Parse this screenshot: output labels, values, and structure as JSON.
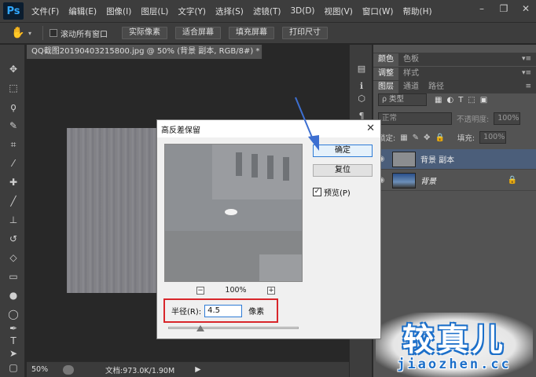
{
  "menubar": {
    "logo": "Ps",
    "items": [
      "文件(F)",
      "编辑(E)",
      "图像(I)",
      "图层(L)",
      "文字(Y)",
      "选择(S)",
      "滤镜(T)",
      "3D(D)",
      "视图(V)",
      "窗口(W)",
      "帮助(H)"
    ]
  },
  "options": {
    "scroll_all_label": "滚动所有窗口",
    "buttons": [
      "实际像素",
      "适合屏幕",
      "填充屏幕",
      "打印尺寸"
    ]
  },
  "document": {
    "tab_title": "QQ截图20190403215800.jpg @ 50% (背景 副本, RGB/8#) *",
    "tab_close": "×",
    "zoom": "50%",
    "doc_info": "文档:973.0K/1.90M"
  },
  "panels": {
    "tabs_row1": [
      "颜色",
      "色板"
    ],
    "tabs_row2": [
      "调整",
      "样式"
    ],
    "tabs_row3": [
      "图层",
      "通道",
      "路径"
    ],
    "filter_label": "ρ 类型",
    "blend_mode": "正常",
    "opacity_label": "不透明度:",
    "opacity_value": "100%",
    "lock_label": "锁定:",
    "fill_label": "填充:",
    "fill_value": "100%",
    "layers": [
      {
        "name": "背景 副本",
        "selected": true
      },
      {
        "name": "背景",
        "selected": false,
        "locked": true
      }
    ]
  },
  "dialog": {
    "title": "高反差保留",
    "ok": "确定",
    "reset": "复位",
    "preview_label": "预览(P)",
    "preview_checked": true,
    "zoom_value": "100%",
    "zoom_minus": "−",
    "zoom_plus": "+",
    "radius_label": "半径(R):",
    "radius_value": "4.5",
    "radius_unit": "像素"
  },
  "watermark": {
    "text": "较真儿",
    "url": "jiaozhen.cc"
  },
  "colors": {
    "accent": "#1c6fc9",
    "highlight_box": "#d8262b",
    "arrow": "#3d6fd1"
  }
}
